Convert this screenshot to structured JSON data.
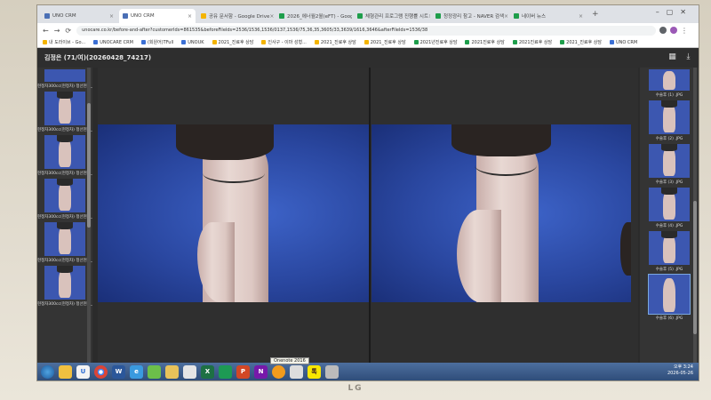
{
  "browser": {
    "tabs": [
      {
        "label": "UNO CRM",
        "active": false
      },
      {
        "label": "UNO CRM",
        "active": true
      },
      {
        "label": "공유 문서함 - Google Drive",
        "active": false
      },
      {
        "label": "2026_에너월2월(eFT) - Google",
        "active": false
      },
      {
        "label": "체형관리 프로그램 진행률 시트",
        "active": false
      },
      {
        "label": "청정광리 참고 - NAVER 검색",
        "active": false
      },
      {
        "label": "네이버 뉴스",
        "active": false
      }
    ],
    "new_tab": "+",
    "url": "unocare.co.kr/before-and-after?customerIds=861535&beforeFileIds=2536/1536,1536/0137,1536/75,36,35,3605/33,3639/1616,3646&afterFileIds=1536/38",
    "bookmarks": [
      "내 도라이브 - Go...",
      "UNOCARE CRM",
      "(회원어)TFull",
      "UNOUK",
      "2021_진료후 상담",
      "인사구 - 이마 성형...",
      "2021_진료후 상담",
      "2021_진료후 상담",
      "2021년진료후 상담",
      "2021진료후 상담",
      "2021진료후 상담",
      "2021_진료후 상담",
      "UNO CRM"
    ]
  },
  "viewer": {
    "title": "김정은 (71/여)(20260428_74217)",
    "left_thumbnails": [
      "현정차300cc(현정차) 정선현포_3",
      "현정차300cc(현정차) 정선현포_3",
      "현정차300cc(현정차) 정선현포_3",
      "현정차300cc(현정차) 정선현포_3",
      "현정차300cc(현정차) 정선현포_3",
      "현정차300cc(현정차) 정선현포_3"
    ],
    "right_thumbnails": [
      "수술후 (1) .JPG",
      "수술후 (2) .JPG",
      "수술후 (3) .JPG",
      "수술후 (4) .JPG",
      "수술후 (5) .JPG",
      "수술후 (6) .JPG"
    ],
    "tooltip": "Onenote 2016"
  },
  "taskbar": {
    "clock_time": "오후 3:24",
    "clock_date": "2026-05-26"
  },
  "monitor": {
    "brand": "LG"
  }
}
